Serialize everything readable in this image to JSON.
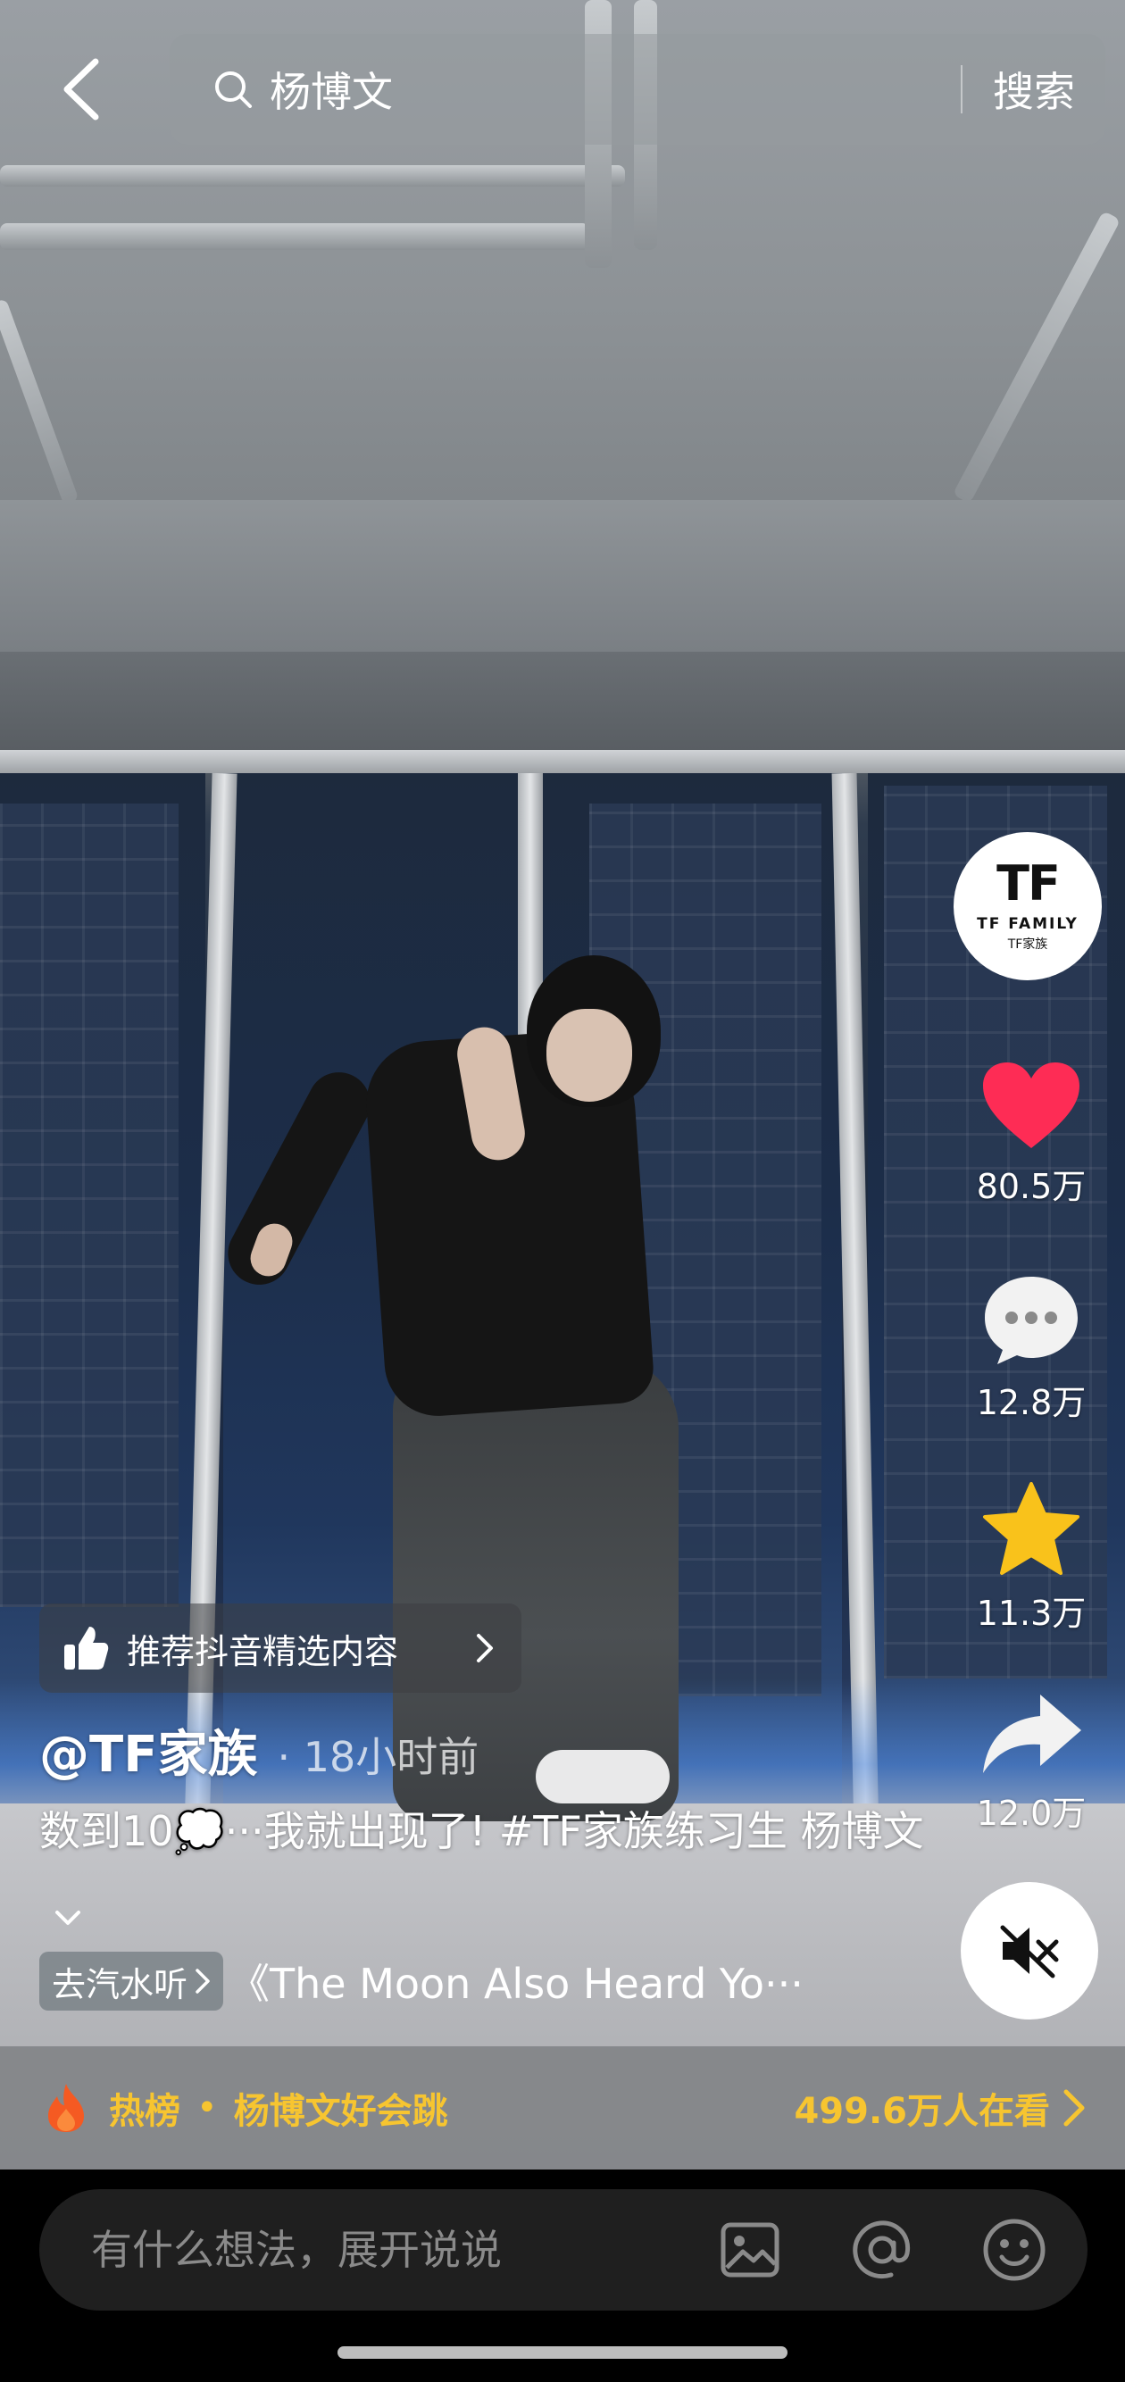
{
  "search": {
    "query": "杨博文",
    "button_label": "搜索"
  },
  "account": {
    "avatar_logo": "TF",
    "avatar_brand": "TF FAMILY",
    "avatar_sub": "TF家族"
  },
  "actions": {
    "likes": "80.5万",
    "comments": "12.8万",
    "favorites": "11.3万",
    "shares": "12.0万"
  },
  "recommend": {
    "label": "推荐抖音精选内容"
  },
  "post": {
    "author": "@TF家族",
    "time": "· 18小时前",
    "caption": "数到10💭···我就出现了! #TF家族练习生 杨博文",
    "music_tag": "去汽水听",
    "music_title": "《The Moon Also Heard Yo···"
  },
  "hot": {
    "label": "热榜",
    "topic": "杨博文好会跳",
    "viewers": "499.6万人在看"
  },
  "comment": {
    "placeholder": "有什么想法，展开说说"
  },
  "colors": {
    "like": "#fe2c55",
    "favorite": "#f9c21b",
    "hot_text": "#f7c530",
    "flame": "#f55a22"
  }
}
